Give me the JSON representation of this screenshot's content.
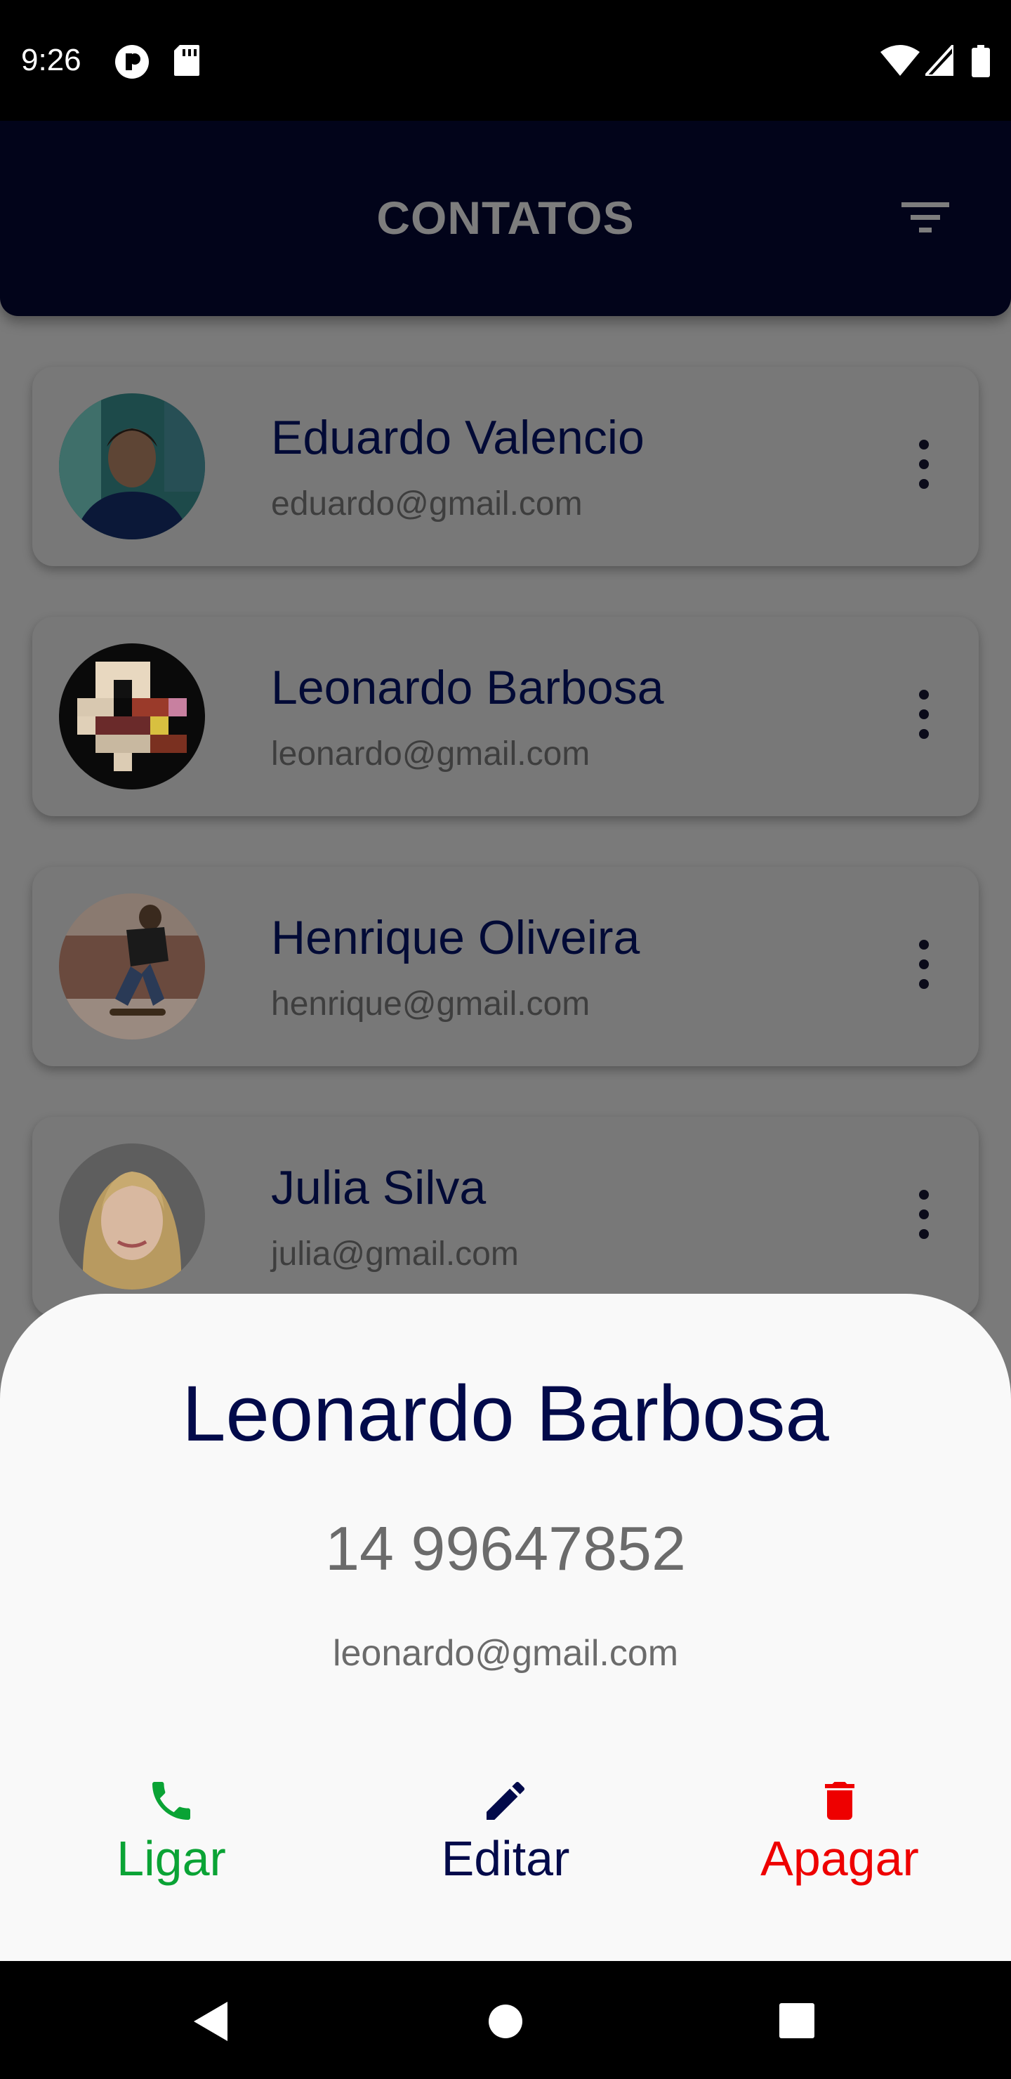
{
  "status_bar": {
    "time": "9:26",
    "icons": [
      "notification-icon",
      "sd-card-icon",
      "wifi-icon",
      "signal-icon",
      "battery-icon"
    ]
  },
  "app_bar": {
    "title": "CONTATOS",
    "filter_icon": "filter-icon"
  },
  "contacts": [
    {
      "name": "Eduardo Valencio",
      "email": "eduardo@gmail.com"
    },
    {
      "name": "Leonardo Barbosa",
      "email": "leonardo@gmail.com"
    },
    {
      "name": "Henrique Oliveira",
      "email": "henrique@gmail.com"
    },
    {
      "name": "Julia Silva",
      "email": "julia@gmail.com"
    }
  ],
  "sheet": {
    "name": "Leonardo Barbosa",
    "phone": "14 99647852",
    "email": "leonardo@gmail.com",
    "actions": {
      "call": {
        "label": "Ligar",
        "icon": "phone-icon",
        "color": "#0aa335"
      },
      "edit": {
        "label": "Editar",
        "icon": "pencil-icon",
        "color": "#020a4a"
      },
      "delete": {
        "label": "Apagar",
        "icon": "trash-icon",
        "color": "#ee0000"
      }
    }
  },
  "nav": {
    "icons": [
      "back-icon",
      "home-icon",
      "recents-icon"
    ]
  },
  "colors": {
    "app_bar": "#02041a",
    "scrim": "#7a7a7a",
    "sheet": "#f9f9f9"
  }
}
